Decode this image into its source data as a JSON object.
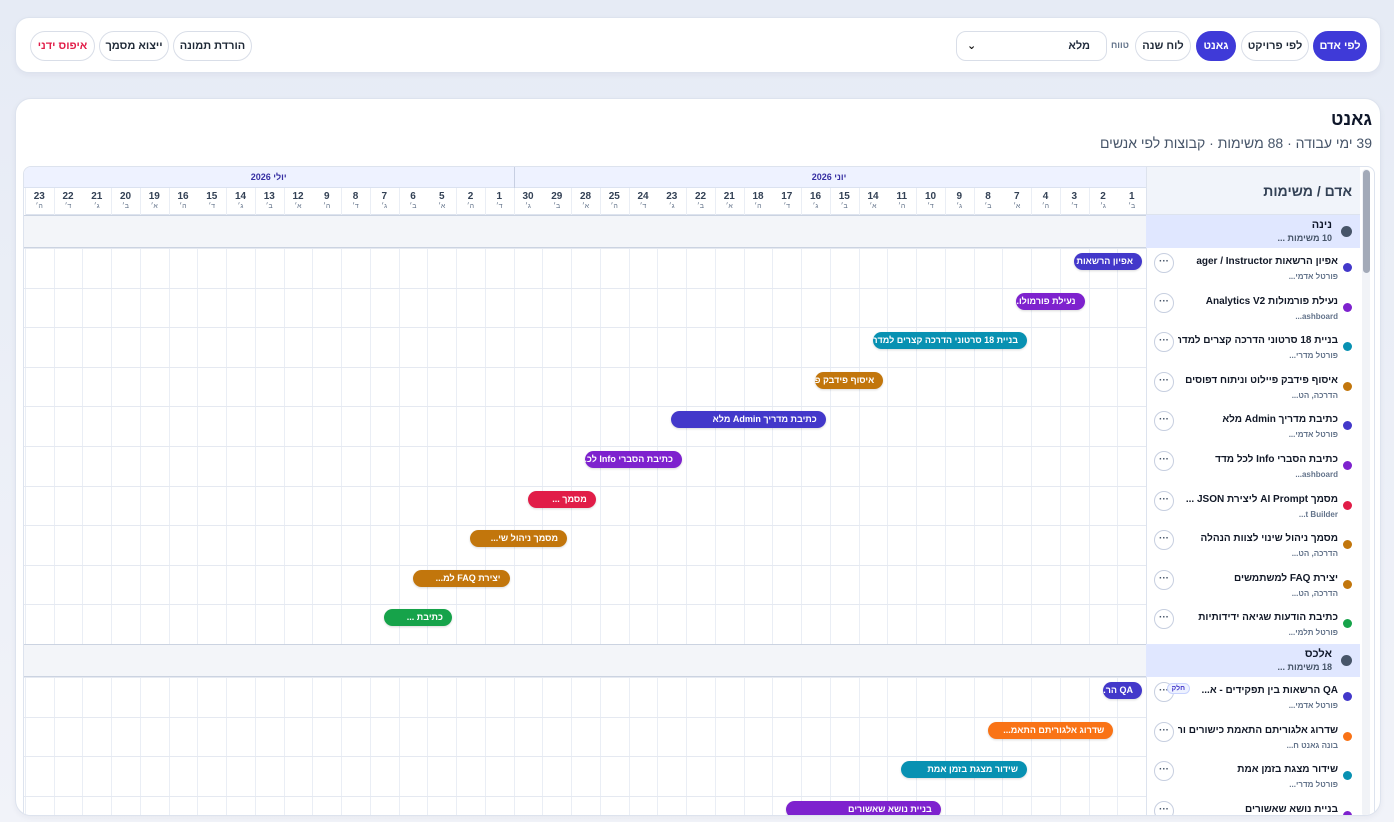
{
  "toolbar": {
    "by_person": "לפי אדם",
    "by_project": "לפי פרויקט",
    "gantt": "גאנט",
    "year_board": "לוח שנה",
    "range_label": "טווח",
    "range_value": "מלא",
    "download_image": "הורדת תמונה",
    "export_doc": "ייצוא מסמך",
    "manual_reset": "איפוס ידני"
  },
  "card": {
    "title": "גאנט",
    "subtitle": "39 ימי עבודה · 88 משימות · קבוצות לפי אנשים"
  },
  "gantt": {
    "side_header": "אדם / משימות",
    "months": [
      {
        "label": "יוני 2026"
      },
      {
        "label": "יולי 2026"
      }
    ],
    "days": [
      {
        "n": "1",
        "w": "ב׳"
      },
      {
        "n": "2",
        "w": "ג׳"
      },
      {
        "n": "3",
        "w": "ד׳"
      },
      {
        "n": "4",
        "w": "ה׳"
      },
      {
        "n": "7",
        "w": "א׳"
      },
      {
        "n": "8",
        "w": "ב׳"
      },
      {
        "n": "9",
        "w": "ג׳"
      },
      {
        "n": "10",
        "w": "ד׳"
      },
      {
        "n": "11",
        "w": "ה׳"
      },
      {
        "n": "14",
        "w": "א׳"
      },
      {
        "n": "15",
        "w": "ב׳"
      },
      {
        "n": "16",
        "w": "ג׳"
      },
      {
        "n": "17",
        "w": "ד׳"
      },
      {
        "n": "18",
        "w": "ה׳"
      },
      {
        "n": "21",
        "w": "א׳"
      },
      {
        "n": "22",
        "w": "ב׳"
      },
      {
        "n": "23",
        "w": "ג׳"
      },
      {
        "n": "24",
        "w": "ד׳"
      },
      {
        "n": "25",
        "w": "ה׳"
      },
      {
        "n": "28",
        "w": "א׳"
      },
      {
        "n": "29",
        "w": "ב׳"
      },
      {
        "n": "30",
        "w": "ג׳"
      },
      {
        "n": "1",
        "w": "ד׳"
      },
      {
        "n": "2",
        "w": "ה׳"
      },
      {
        "n": "5",
        "w": "א׳"
      },
      {
        "n": "6",
        "w": "ב׳"
      },
      {
        "n": "7",
        "w": "ג׳"
      },
      {
        "n": "8",
        "w": "ד׳"
      },
      {
        "n": "9",
        "w": "ה׳"
      },
      {
        "n": "12",
        "w": "א׳"
      },
      {
        "n": "13",
        "w": "ב׳"
      },
      {
        "n": "14",
        "w": "ג׳"
      },
      {
        "n": "15",
        "w": "ד׳"
      },
      {
        "n": "16",
        "w": "ה׳"
      },
      {
        "n": "19",
        "w": "א׳"
      },
      {
        "n": "20",
        "w": "ב׳"
      },
      {
        "n": "21",
        "w": "ג׳"
      },
      {
        "n": "22",
        "w": "ד׳"
      },
      {
        "n": "23",
        "w": "ה׳"
      }
    ],
    "groups": [
      {
        "name": "נינה",
        "count": "10 משימות ...",
        "tasks": [
          {
            "title": "אפיון הרשאות ager / Instructor",
            "sub": "פורטל אדמי...",
            "color": "#4338ca",
            "bar": "אפיון הרשאות ...",
            "start": 0,
            "end": 2
          },
          {
            "title": "נעילת פורמולות Analytics V2",
            "sub": "ashboard...",
            "color": "#7e22ce",
            "bar": "נעילת פורמולו...",
            "start": 2,
            "end": 4
          },
          {
            "title": "בניית 18 סרטוני הדרכה קצרים למדר...",
            "sub": "פורטל מדרי...",
            "color": "#0891b2",
            "bar": "בניית 18 סרטוני הדרכה קצרים למדריכות",
            "start": 4,
            "end": 9
          },
          {
            "title": "איסוף פידבק פיילוט וניתוח דפוסים",
            "sub": "הדרכה, הט...",
            "color": "#c2760c",
            "bar": "איסוף פידבק פי...",
            "start": 9,
            "end": 11
          },
          {
            "title": "כתיבת מדריך Admin מלא",
            "sub": "פורטל אדמי...",
            "color": "#4338ca",
            "bar": "כתיבת מדריך Admin מלא",
            "start": 11,
            "end": 16
          },
          {
            "title": "כתיבת הסברי Info לכל מדד",
            "sub": "ashboard...",
            "color": "#7e22ce",
            "bar": "כתיבת הסברי Info לכ...",
            "start": 16,
            "end": 19
          },
          {
            "title": "מסמך AI Prompt ליצירת JSON ...",
            "sub": "t Builder...",
            "color": "#e11d48",
            "bar": "מסמך ...",
            "start": 19,
            "end": 21
          },
          {
            "title": "מסמך ניהול שינוי לצוות הנהלה",
            "sub": "הדרכה, הט...",
            "color": "#c2760c",
            "bar": "מסמך ניהול שי...",
            "start": 20,
            "end": 23
          },
          {
            "title": "יצירת FAQ למשתמשים",
            "sub": "הדרכה, הט...",
            "color": "#c2760c",
            "bar": "יצירת FAQ למ...",
            "start": 22,
            "end": 25
          },
          {
            "title": "כתיבת הודעות שגיאה ידידותיות",
            "sub": "פורטל תלמי...",
            "color": "#16a34a",
            "bar": "כתיבת ...",
            "start": 24,
            "end": 26
          }
        ]
      },
      {
        "name": "אלכס",
        "count": "18 משימות ...",
        "tasks": [
          {
            "title": "QA הרשאות בין תפקידים - א...",
            "sub": "פורטל אדמי...",
            "color": "#4338ca",
            "bar": "QA הר...",
            "start": 0,
            "end": 1,
            "tag": "חלק"
          },
          {
            "title": "שדרוג אלגוריתם התאמת כישורים ור...",
            "sub": "בונה גאנט ח...",
            "color": "#f97316",
            "bar": "שדרוג אלגוריתם התאמ...",
            "start": 1,
            "end": 5
          },
          {
            "title": "שידור מצגת בזמן אמת",
            "sub": "פורטל מדרי...",
            "color": "#0891b2",
            "bar": "שידור מצגת בזמן אמת",
            "start": 4,
            "end": 8
          },
          {
            "title": "בניית נושא שאשורים",
            "sub": "",
            "color": "#7e22ce",
            "bar": "בניית נושא שאשורים",
            "start": 7,
            "end": 12
          }
        ]
      }
    ]
  }
}
